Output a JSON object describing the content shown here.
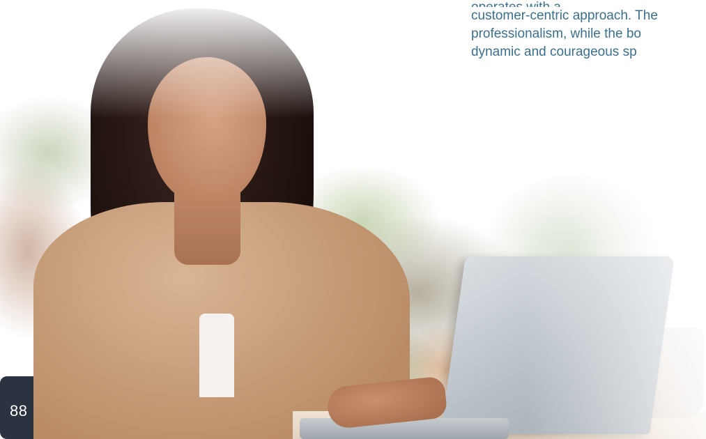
{
  "page": {
    "number": "88"
  },
  "body_text": {
    "line_top_partial": "operates with a",
    "line_1": "customer-centric approach. The",
    "line_2": "professionalism, while the bo",
    "line_3": "dynamic and courageous sp"
  },
  "photo": {
    "subject": "woman-using-laptop-photo"
  }
}
